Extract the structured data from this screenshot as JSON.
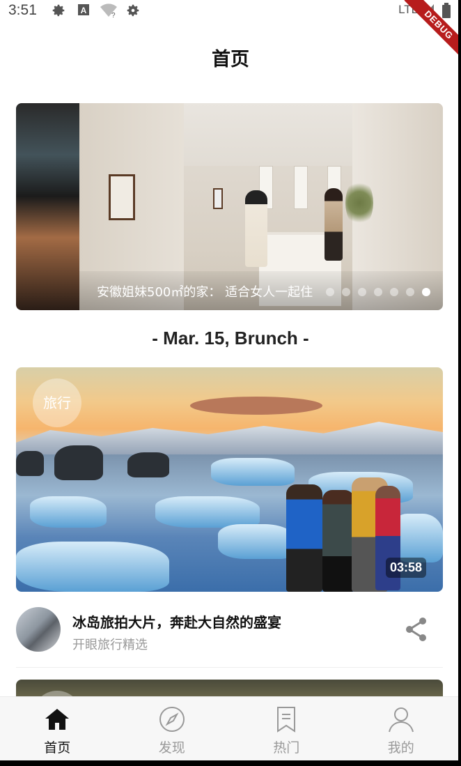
{
  "status_bar": {
    "time": "3:51",
    "network": "LTE",
    "icons": [
      "gear-icon",
      "a-icon",
      "wifi-question-icon",
      "gear-icon",
      "signal-icon",
      "battery-icon"
    ],
    "debug_label": "DEBUG"
  },
  "app_bar": {
    "title": "首页"
  },
  "banner": {
    "caption": "安徽姐妹500㎡的家：  适合女人一起住",
    "dot_count": 7,
    "active_dot": 6
  },
  "date_header": "- Mar. 15, Brunch -",
  "video_card": {
    "category_badge": "旅行",
    "duration": "03:58",
    "title": "冰岛旅拍大片，奔赴大自然的盛宴",
    "author": "开眼旅行精选"
  },
  "bottom_nav": {
    "items": [
      {
        "label": "首页",
        "icon": "home-icon",
        "active": true
      },
      {
        "label": "发现",
        "icon": "compass-icon",
        "active": false
      },
      {
        "label": "热门",
        "icon": "bookmark-icon",
        "active": false
      },
      {
        "label": "我的",
        "icon": "person-icon",
        "active": false
      }
    ]
  },
  "colors": {
    "active": "#111111",
    "inactive": "#999999",
    "debug_banner": "#b71c1c"
  }
}
